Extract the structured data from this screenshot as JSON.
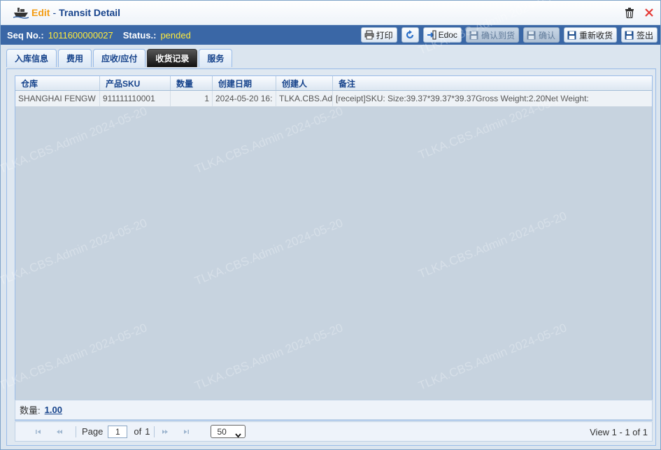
{
  "window": {
    "edit_label": "Edit",
    "separator": "-",
    "title": "Transit Detail"
  },
  "info": {
    "seq_label": "Seq No.:",
    "seq_value": "1011600000027",
    "status_label": "Status.:",
    "status_value": "pended"
  },
  "toolbar": {
    "print": "打印",
    "edoc": "Edoc",
    "confirm_arrival": "确认到货",
    "confirm": "确认",
    "re_receive": "重新收货",
    "sign_out": "签出"
  },
  "tabs": [
    {
      "label": "入库信息"
    },
    {
      "label": "费用"
    },
    {
      "label": "应收/应付"
    },
    {
      "label": "收货记录"
    },
    {
      "label": "服务"
    }
  ],
  "grid": {
    "columns": [
      "仓库",
      "产品SKU",
      "数量",
      "创建日期",
      "创建人",
      "备注"
    ],
    "rows": [
      [
        "SHANGHAI FENGW",
        "911111110001",
        "1",
        "2024-05-20 16:",
        "TLKA.CBS.Ad",
        "[receipt]SKU: Size:39.37*39.37*39.37Gross Weight:2.20Net Weight:"
      ]
    ]
  },
  "summary": {
    "label": "数量:",
    "value": "1.00"
  },
  "pager": {
    "page_label": "Page",
    "page_value": "1",
    "of_label": "of",
    "total_pages": "1",
    "page_size": "50",
    "view_text": "View  1 - 1  of 1"
  },
  "watermark_text": "TLKA.CBS.Admin 2024-05-20",
  "colors": {
    "accent": "#3a67a6",
    "status": "#ffeb3b",
    "title": "#15428b",
    "edit": "#f39c12",
    "close": "#e53935"
  }
}
